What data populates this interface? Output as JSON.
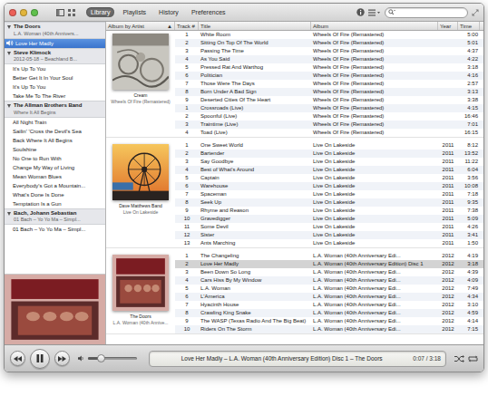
{
  "toolbar": {
    "tabs": [
      {
        "label": "Library",
        "selected": true
      },
      {
        "label": "Playlists",
        "selected": false
      },
      {
        "label": "History",
        "selected": false
      },
      {
        "label": "Preferences",
        "selected": false
      }
    ]
  },
  "sidebar": {
    "art_kind": "doors",
    "groups": [
      {
        "artist": "The Doors",
        "album": "L.A. Woman (40th Annivers...",
        "expanded": true,
        "items": [
          {
            "title": "Love Her Madly",
            "selected": true,
            "playing": true
          }
        ]
      },
      {
        "artist": "Steve Klimock",
        "album": "2012-05-18 – Beachland B...",
        "expanded": true,
        "items": [
          {
            "title": "It's Up To You",
            "selected": false,
            "playing": false
          },
          {
            "title": "Better Get It In Your Soul",
            "selected": false,
            "playing": false
          },
          {
            "title": "It's Up To You",
            "selected": false,
            "playing": false
          },
          {
            "title": "Take Me To The River",
            "selected": false,
            "playing": false
          }
        ]
      },
      {
        "artist": "The Allman Brothers Band",
        "album": "Where It All Begins",
        "expanded": true,
        "items": [
          {
            "title": "All Night Train",
            "selected": false,
            "playing": false
          },
          {
            "title": "Sailin' 'Cross the Devil's Sea",
            "selected": false,
            "playing": false
          },
          {
            "title": "Back Where It All Begins",
            "selected": false,
            "playing": false
          },
          {
            "title": "Soulshine",
            "selected": false,
            "playing": false
          },
          {
            "title": "No One to Run With",
            "selected": false,
            "playing": false
          },
          {
            "title": "Change My Way of Living",
            "selected": false,
            "playing": false
          },
          {
            "title": "Mean Woman Blues",
            "selected": false,
            "playing": false
          },
          {
            "title": "Everybody's Got a Mountain...",
            "selected": false,
            "playing": false
          },
          {
            "title": "What's Done Is Done",
            "selected": false,
            "playing": false
          },
          {
            "title": "Temptation Is a Gun",
            "selected": false,
            "playing": false
          }
        ]
      },
      {
        "artist": "Bach, Johann Sebastian",
        "album": "01 Bach – Yo Yo Ma – Simpl...",
        "expanded": true,
        "items": [
          {
            "title": "01 Bach – Yo Yo Ma – Simpl...",
            "selected": false,
            "playing": false
          }
        ]
      }
    ]
  },
  "table": {
    "columns": [
      {
        "label": "Album by Artist",
        "indicator": "▲"
      },
      {
        "label": "Track #"
      },
      {
        "label": "Title"
      },
      {
        "label": "Album"
      },
      {
        "label": "Year"
      },
      {
        "label": "Time"
      }
    ],
    "groups": [
      {
        "artist": "Cream",
        "album": "Wheels Of Fire (Remastered)",
        "art_kind": "cream",
        "rows": [
          {
            "track": "1",
            "title": "White Room",
            "album": "Wheels Of Fire (Remastered)",
            "time": "5:00",
            "selected": false
          },
          {
            "track": "2",
            "title": "Sitting On Top Of The World",
            "album": "Wheels Of Fire (Remastered)",
            "time": "5:01",
            "selected": false
          },
          {
            "track": "3",
            "title": "Passing The Time",
            "album": "Wheels Of Fire (Remastered)",
            "time": "4:37",
            "selected": false
          },
          {
            "track": "4",
            "title": "As You Said",
            "album": "Wheels Of Fire (Remastered)",
            "time": "4:22",
            "selected": false
          },
          {
            "track": "5",
            "title": "Pressed Rat And Warthog",
            "album": "Wheels Of Fire (Remastered)",
            "time": "3:18",
            "selected": false
          },
          {
            "track": "6",
            "title": "Politician",
            "album": "Wheels Of Fire (Remastered)",
            "time": "4:16",
            "selected": false
          },
          {
            "track": "7",
            "title": "Those Were The Days",
            "album": "Wheels Of Fire (Remastered)",
            "time": "2:57",
            "selected": false
          },
          {
            "track": "8",
            "title": "Born Under A Bad Sign",
            "album": "Wheels Of Fire (Remastered)",
            "time": "3:13",
            "selected": false
          },
          {
            "track": "9",
            "title": "Deserted Cities Of The Heart",
            "album": "Wheels Of Fire (Remastered)",
            "time": "3:38",
            "selected": false
          },
          {
            "track": "1",
            "title": "Crossroads (Live)",
            "album": "Wheels Of Fire (Remastered)",
            "time": "4:15",
            "selected": false
          },
          {
            "track": "2",
            "title": "Spoonful (Live)",
            "album": "Wheels Of Fire (Remastered)",
            "time": "16:46",
            "selected": false
          },
          {
            "track": "3",
            "title": "Traintime (Live)",
            "album": "Wheels Of Fire (Remastered)",
            "time": "7:01",
            "selected": false
          },
          {
            "track": "4",
            "title": "Toad (Live)",
            "album": "Wheels Of Fire (Remastered)",
            "time": "16:15",
            "selected": false
          }
        ]
      },
      {
        "artist": "Dave Matthews Band",
        "album": "Live On Lakeside",
        "art_kind": "dave",
        "rows": [
          {
            "track": "1",
            "title": "One Sweet World",
            "album": "Live On Lakeside",
            "year": "2011",
            "time": "8:12",
            "selected": false
          },
          {
            "track": "2",
            "title": "Bartender",
            "album": "Live On Lakeside",
            "year": "2011",
            "time": "13:52",
            "selected": false
          },
          {
            "track": "3",
            "title": "Say Goodbye",
            "album": "Live On Lakeside",
            "year": "2011",
            "time": "11:22",
            "selected": false
          },
          {
            "track": "4",
            "title": "Best of What's Around",
            "album": "Live On Lakeside",
            "year": "2011",
            "time": "6:04",
            "selected": false
          },
          {
            "track": "5",
            "title": "Captain",
            "album": "Live On Lakeside",
            "year": "2011",
            "time": "3:56",
            "selected": false
          },
          {
            "track": "6",
            "title": "Warehouse",
            "album": "Live On Lakeside",
            "year": "2011",
            "time": "10:08",
            "selected": false
          },
          {
            "track": "7",
            "title": "Spaceman",
            "album": "Live On Lakeside",
            "year": "2011",
            "time": "7:18",
            "selected": false
          },
          {
            "track": "8",
            "title": "Seek Up",
            "album": "Live On Lakeside",
            "year": "2011",
            "time": "9:35",
            "selected": false
          },
          {
            "track": "9",
            "title": "Rhyme and Reason",
            "album": "Live On Lakeside",
            "year": "2011",
            "time": "7:38",
            "selected": false
          },
          {
            "track": "10",
            "title": "Gravedigger",
            "album": "Live On Lakeside",
            "year": "2011",
            "time": "5:09",
            "selected": false
          },
          {
            "track": "11",
            "title": "Some Devil",
            "album": "Live On Lakeside",
            "year": "2011",
            "time": "4:26",
            "selected": false
          },
          {
            "track": "12",
            "title": "Sister",
            "album": "Live On Lakeside",
            "year": "2011",
            "time": "3:41",
            "selected": false
          },
          {
            "track": "13",
            "title": "Ants Marching",
            "album": "Live On Lakeside",
            "year": "2011",
            "time": "1:50",
            "selected": false
          }
        ]
      },
      {
        "artist": "The Doors",
        "album": "L.A. Woman (40th Annive...",
        "art_kind": "doors",
        "rows": [
          {
            "track": "1",
            "title": "The Changeling",
            "album": "L.A. Woman (40th Anniversary Edi...",
            "year": "2012",
            "time": "4:19",
            "selected": false
          },
          {
            "track": "2",
            "title": "Love Her Madly",
            "album": "L.A. Woman (40th Anniversary Edition) Disc 1",
            "year": "2012",
            "time": "3:18",
            "selected": true
          },
          {
            "track": "3",
            "title": "Been Down So Long",
            "album": "L.A. Woman (40th Anniversary Edi...",
            "year": "2012",
            "time": "4:39",
            "selected": false
          },
          {
            "track": "4",
            "title": "Cars Hiss By My Window",
            "album": "L.A. Woman (40th Anniversary Edi...",
            "year": "2012",
            "time": "4:09",
            "selected": false
          },
          {
            "track": "5",
            "title": "L.A. Woman",
            "album": "L.A. Woman (40th Anniversary Edi...",
            "year": "2012",
            "time": "7:49",
            "selected": false
          },
          {
            "track": "6",
            "title": "L'America",
            "album": "L.A. Woman (40th Anniversary Edi...",
            "year": "2012",
            "time": "4:34",
            "selected": false
          },
          {
            "track": "7",
            "title": "Hyacinth House",
            "album": "L.A. Woman (40th Anniversary Edi...",
            "year": "2012",
            "time": "3:10",
            "selected": false
          },
          {
            "track": "8",
            "title": "Crawling King Snake",
            "album": "L.A. Woman (40th Anniversary Edi...",
            "year": "2012",
            "time": "4:59",
            "selected": false
          },
          {
            "track": "9",
            "title": "The WASP (Texas Radio And The Big Beat)",
            "album": "L.A. Woman (40th Anniversary Edi...",
            "year": "2012",
            "time": "4:14",
            "selected": false
          },
          {
            "track": "10",
            "title": "Riders On The Storm",
            "album": "L.A. Woman (40th Anniversary Edi...",
            "year": "2012",
            "time": "7:15",
            "selected": false
          }
        ]
      }
    ]
  },
  "player": {
    "playing": true,
    "volume": {
      "level": 0.25
    },
    "now_playing": {
      "text": "Love Her Madly – L.A. Woman (40th Anniversary Edition) Disc 1 – The Doors",
      "time": "0:07 / 3:18"
    }
  }
}
